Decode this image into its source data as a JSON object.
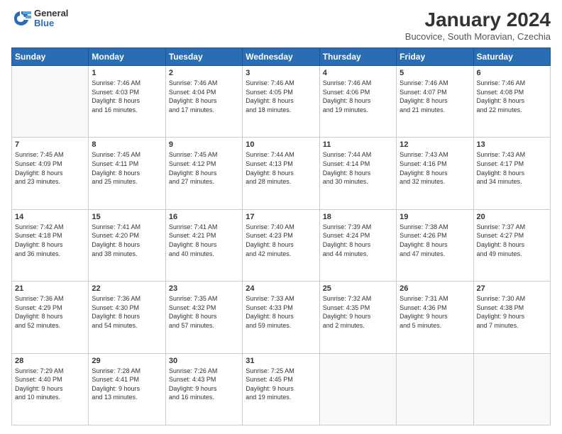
{
  "header": {
    "logo_line1": "General",
    "logo_line2": "Blue",
    "title": "January 2024",
    "subtitle": "Bucovice, South Moravian, Czechia"
  },
  "weekdays": [
    "Sunday",
    "Monday",
    "Tuesday",
    "Wednesday",
    "Thursday",
    "Friday",
    "Saturday"
  ],
  "weeks": [
    [
      {
        "day": "",
        "info": ""
      },
      {
        "day": "1",
        "info": "Sunrise: 7:46 AM\nSunset: 4:03 PM\nDaylight: 8 hours\nand 16 minutes."
      },
      {
        "day": "2",
        "info": "Sunrise: 7:46 AM\nSunset: 4:04 PM\nDaylight: 8 hours\nand 17 minutes."
      },
      {
        "day": "3",
        "info": "Sunrise: 7:46 AM\nSunset: 4:05 PM\nDaylight: 8 hours\nand 18 minutes."
      },
      {
        "day": "4",
        "info": "Sunrise: 7:46 AM\nSunset: 4:06 PM\nDaylight: 8 hours\nand 19 minutes."
      },
      {
        "day": "5",
        "info": "Sunrise: 7:46 AM\nSunset: 4:07 PM\nDaylight: 8 hours\nand 21 minutes."
      },
      {
        "day": "6",
        "info": "Sunrise: 7:46 AM\nSunset: 4:08 PM\nDaylight: 8 hours\nand 22 minutes."
      }
    ],
    [
      {
        "day": "7",
        "info": "Sunrise: 7:45 AM\nSunset: 4:09 PM\nDaylight: 8 hours\nand 23 minutes."
      },
      {
        "day": "8",
        "info": "Sunrise: 7:45 AM\nSunset: 4:11 PM\nDaylight: 8 hours\nand 25 minutes."
      },
      {
        "day": "9",
        "info": "Sunrise: 7:45 AM\nSunset: 4:12 PM\nDaylight: 8 hours\nand 27 minutes."
      },
      {
        "day": "10",
        "info": "Sunrise: 7:44 AM\nSunset: 4:13 PM\nDaylight: 8 hours\nand 28 minutes."
      },
      {
        "day": "11",
        "info": "Sunrise: 7:44 AM\nSunset: 4:14 PM\nDaylight: 8 hours\nand 30 minutes."
      },
      {
        "day": "12",
        "info": "Sunrise: 7:43 AM\nSunset: 4:16 PM\nDaylight: 8 hours\nand 32 minutes."
      },
      {
        "day": "13",
        "info": "Sunrise: 7:43 AM\nSunset: 4:17 PM\nDaylight: 8 hours\nand 34 minutes."
      }
    ],
    [
      {
        "day": "14",
        "info": "Sunrise: 7:42 AM\nSunset: 4:18 PM\nDaylight: 8 hours\nand 36 minutes."
      },
      {
        "day": "15",
        "info": "Sunrise: 7:41 AM\nSunset: 4:20 PM\nDaylight: 8 hours\nand 38 minutes."
      },
      {
        "day": "16",
        "info": "Sunrise: 7:41 AM\nSunset: 4:21 PM\nDaylight: 8 hours\nand 40 minutes."
      },
      {
        "day": "17",
        "info": "Sunrise: 7:40 AM\nSunset: 4:23 PM\nDaylight: 8 hours\nand 42 minutes."
      },
      {
        "day": "18",
        "info": "Sunrise: 7:39 AM\nSunset: 4:24 PM\nDaylight: 8 hours\nand 44 minutes."
      },
      {
        "day": "19",
        "info": "Sunrise: 7:38 AM\nSunset: 4:26 PM\nDaylight: 8 hours\nand 47 minutes."
      },
      {
        "day": "20",
        "info": "Sunrise: 7:37 AM\nSunset: 4:27 PM\nDaylight: 8 hours\nand 49 minutes."
      }
    ],
    [
      {
        "day": "21",
        "info": "Sunrise: 7:36 AM\nSunset: 4:29 PM\nDaylight: 8 hours\nand 52 minutes."
      },
      {
        "day": "22",
        "info": "Sunrise: 7:36 AM\nSunset: 4:30 PM\nDaylight: 8 hours\nand 54 minutes."
      },
      {
        "day": "23",
        "info": "Sunrise: 7:35 AM\nSunset: 4:32 PM\nDaylight: 8 hours\nand 57 minutes."
      },
      {
        "day": "24",
        "info": "Sunrise: 7:33 AM\nSunset: 4:33 PM\nDaylight: 8 hours\nand 59 minutes."
      },
      {
        "day": "25",
        "info": "Sunrise: 7:32 AM\nSunset: 4:35 PM\nDaylight: 9 hours\nand 2 minutes."
      },
      {
        "day": "26",
        "info": "Sunrise: 7:31 AM\nSunset: 4:36 PM\nDaylight: 9 hours\nand 5 minutes."
      },
      {
        "day": "27",
        "info": "Sunrise: 7:30 AM\nSunset: 4:38 PM\nDaylight: 9 hours\nand 7 minutes."
      }
    ],
    [
      {
        "day": "28",
        "info": "Sunrise: 7:29 AM\nSunset: 4:40 PM\nDaylight: 9 hours\nand 10 minutes."
      },
      {
        "day": "29",
        "info": "Sunrise: 7:28 AM\nSunset: 4:41 PM\nDaylight: 9 hours\nand 13 minutes."
      },
      {
        "day": "30",
        "info": "Sunrise: 7:26 AM\nSunset: 4:43 PM\nDaylight: 9 hours\nand 16 minutes."
      },
      {
        "day": "31",
        "info": "Sunrise: 7:25 AM\nSunset: 4:45 PM\nDaylight: 9 hours\nand 19 minutes."
      },
      {
        "day": "",
        "info": ""
      },
      {
        "day": "",
        "info": ""
      },
      {
        "day": "",
        "info": ""
      }
    ]
  ]
}
